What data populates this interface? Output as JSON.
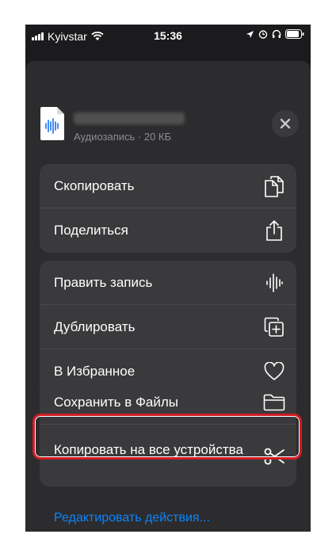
{
  "status_bar": {
    "carrier": "Kyivstar",
    "time": "15:36"
  },
  "file": {
    "meta": "Аудиозапись · 20 КБ"
  },
  "groups": [
    {
      "items": [
        {
          "label": "Скопировать",
          "icon": "copy-icon"
        },
        {
          "label": "Поделиться",
          "icon": "share-icon"
        }
      ]
    },
    {
      "items": [
        {
          "label": "Править запись",
          "icon": "waveform-icon"
        },
        {
          "label": "Дублировать",
          "icon": "duplicate-icon"
        },
        {
          "label": "В Избранное",
          "icon": "heart-icon"
        }
      ]
    },
    {
      "items": [
        {
          "label": "Сохранить в Файлы",
          "icon": "folder-icon"
        },
        {
          "label": "Копировать на все устройства",
          "icon": "scissors-icon"
        }
      ]
    }
  ],
  "edit_actions_label": "Редактировать действия...",
  "colors": {
    "sheet_bg": "#2c2c2e",
    "row_bg": "#3a3a3c",
    "link": "#0a84ff",
    "highlight": "#d01c24"
  }
}
